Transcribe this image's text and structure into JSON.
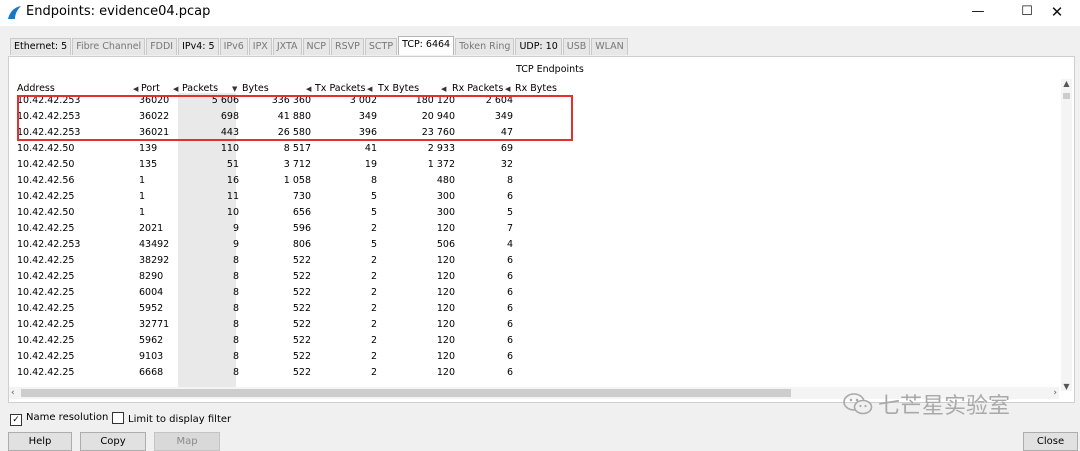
{
  "window": {
    "title": "Endpoints: evidence04.pcap",
    "min_glyph": "—",
    "max_glyph": "☐",
    "close_glyph": "✕"
  },
  "tabs": [
    {
      "label": "Ethernet: 5",
      "state": "enabled"
    },
    {
      "label": "Fibre Channel",
      "state": "disabled"
    },
    {
      "label": "FDDI",
      "state": "disabled"
    },
    {
      "label": "IPv4: 5",
      "state": "enabled"
    },
    {
      "label": "IPv6",
      "state": "disabled"
    },
    {
      "label": "IPX",
      "state": "disabled"
    },
    {
      "label": "JXTA",
      "state": "disabled"
    },
    {
      "label": "NCP",
      "state": "disabled"
    },
    {
      "label": "RSVP",
      "state": "disabled"
    },
    {
      "label": "SCTP",
      "state": "disabled"
    },
    {
      "label": "TCP: 6464",
      "state": "active"
    },
    {
      "label": "Token Ring",
      "state": "disabled"
    },
    {
      "label": "UDP: 10",
      "state": "enabled"
    },
    {
      "label": "USB",
      "state": "disabled"
    },
    {
      "label": "WLAN",
      "state": "disabled"
    }
  ],
  "panel_caption": "TCP Endpoints",
  "columns": {
    "address": "Address",
    "port": "Port",
    "packets": "Packets",
    "bytes": "Bytes",
    "tx_packets": "Tx Packets",
    "tx_bytes": "Tx Bytes",
    "rx_packets": "Rx Packets",
    "rx_bytes": "Rx Bytes"
  },
  "sort_glyph": "◀",
  "sort_active_glyph": "▼",
  "rows": [
    [
      "10.42.42.253",
      "36020",
      "5 606",
      "336 360",
      "3 002",
      "180 120",
      "2 604"
    ],
    [
      "10.42.42.253",
      "36022",
      "698",
      "41 880",
      "349",
      "20 940",
      "349"
    ],
    [
      "10.42.42.253",
      "36021",
      "443",
      "26 580",
      "396",
      "23 760",
      "47"
    ],
    [
      "10.42.42.50",
      "139",
      "110",
      "8 517",
      "41",
      "2 933",
      "69"
    ],
    [
      "10.42.42.50",
      "135",
      "51",
      "3 712",
      "19",
      "1 372",
      "32"
    ],
    [
      "10.42.42.56",
      "1",
      "16",
      "1 058",
      "8",
      "480",
      "8"
    ],
    [
      "10.42.42.25",
      "1",
      "11",
      "730",
      "5",
      "300",
      "6"
    ],
    [
      "10.42.42.50",
      "1",
      "10",
      "656",
      "5",
      "300",
      "5"
    ],
    [
      "10.42.42.25",
      "2021",
      "9",
      "596",
      "2",
      "120",
      "7"
    ],
    [
      "10.42.42.253",
      "43492",
      "9",
      "806",
      "5",
      "506",
      "4"
    ],
    [
      "10.42.42.25",
      "38292",
      "8",
      "522",
      "2",
      "120",
      "6"
    ],
    [
      "10.42.42.25",
      "8290",
      "8",
      "522",
      "2",
      "120",
      "6"
    ],
    [
      "10.42.42.25",
      "6004",
      "8",
      "522",
      "2",
      "120",
      "6"
    ],
    [
      "10.42.42.25",
      "5952",
      "8",
      "522",
      "2",
      "120",
      "6"
    ],
    [
      "10.42.42.25",
      "32771",
      "8",
      "522",
      "2",
      "120",
      "6"
    ],
    [
      "10.42.42.25",
      "5962",
      "8",
      "522",
      "2",
      "120",
      "6"
    ],
    [
      "10.42.42.25",
      "9103",
      "8",
      "522",
      "2",
      "120",
      "6"
    ],
    [
      "10.42.42.25",
      "6668",
      "8",
      "522",
      "2",
      "120",
      "6"
    ]
  ],
  "highlight_color": "#e0312d",
  "options": {
    "name_resolution": {
      "label": "Name resolution",
      "checked": true
    },
    "limit_filter": {
      "label": "Limit to display filter",
      "checked": false
    }
  },
  "check_glyph": "✓",
  "buttons": {
    "help": "Help",
    "copy": "Copy",
    "map": "Map",
    "close": "Close"
  },
  "scroll": {
    "up": "▲",
    "down": "▼",
    "left": "‹",
    "right": "›"
  },
  "watermark": {
    "text": "七芒星实验室",
    "icon": "wechat-icon"
  }
}
